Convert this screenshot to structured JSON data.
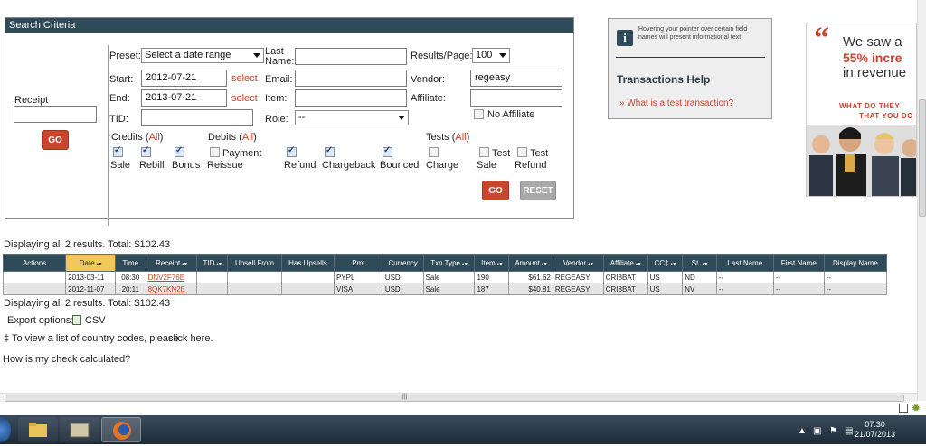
{
  "search": {
    "header": "Search Criteria",
    "receipt_label": "Receipt",
    "receipt_value": "",
    "go_left": "GO",
    "preset_label": "Preset:",
    "preset_value": "Select a date range",
    "start_label": "Start:",
    "start_value": "2012-07-21",
    "end_label": "End:",
    "end_value": "2013-07-21",
    "select_link": "select",
    "tid_label": "TID:",
    "tid_value": "",
    "lastname_label_1": "Last",
    "lastname_label_2": "Name:",
    "lastname_value": "",
    "email_label": "Email:",
    "email_value": "",
    "item_label": "Item:",
    "item_value": "",
    "role_label": "Role:",
    "role_value": "--",
    "results_label": "Results/Page:",
    "results_value": "100",
    "vendor_label": "Vendor:",
    "vendor_value": "regeasy",
    "affiliate_label": "Affiliate:",
    "affiliate_value": "",
    "no_affiliate_label": "No Affiliate",
    "credits_label": "Credits (",
    "debits_label": "Debits (",
    "tests_label": "Tests (",
    "all_link": "All",
    "close_paren": ")",
    "cb_sale": "Sale",
    "cb_rebill": "Rebill",
    "cb_bonus": "Bonus",
    "cb_payment": "Payment",
    "cb_reissue": "Reissue",
    "cb_refund": "Refund",
    "cb_chargeback": "Chargeback",
    "cb_bounced": "Bounced",
    "cb_charge": "Charge",
    "cb_test": "Test",
    "cb_test_sale": "Sale",
    "cb_test_refund": "Refund",
    "go_right": "GO",
    "reset": "RESET"
  },
  "help": {
    "hover_text": "Hovering your pointer over certain field names will present informational text.",
    "title": "Transactions Help",
    "link_bullet": "»",
    "link": "What is a test transaction?"
  },
  "ad": {
    "line1": "We saw a",
    "line2": "55% incre",
    "line3": "in revenue",
    "line4": "WHAT DO THEY",
    "line5": "THAT YOU DO"
  },
  "results": {
    "summary_top": "Displaying all 2 results.",
    "total_top": "Total: $102.43",
    "summary_bottom": "Displaying all 2 results.",
    "total_bottom": "Total: $102.43",
    "export_label": "Export options:",
    "csv": "CSV",
    "country_prefix": "‡ To view a list of country codes, please",
    "country_link": "click here.",
    "check_link": "How is my check calculated?",
    "columns": [
      "Actions",
      "Date",
      "Time",
      "Receipt",
      "TID",
      "Upsell From",
      "Has Upsells",
      "Pmt",
      "Currency",
      "Txn Type",
      "Item",
      "Amount",
      "Vendor",
      "Affiliate",
      "CC‡",
      "St.",
      "Last Name",
      "First Name",
      "Display Name"
    ],
    "rows": [
      [
        "",
        "2013-03-11",
        "08:30",
        "DNV2F76E",
        "",
        "",
        "",
        "PYPL",
        "USD",
        "Sale",
        "190",
        "$61.62",
        "REGEASY",
        "CRI8BAT",
        "US",
        "ND",
        "--",
        "--",
        "--"
      ],
      [
        "",
        "2012-11-07",
        "20:11",
        "8QK7KN2E",
        "",
        "",
        "",
        "VISA",
        "USD",
        "Sale",
        "187",
        "$40.81",
        "REGEASY",
        "CRI8BAT",
        "US",
        "NV",
        "--",
        "--",
        "--"
      ]
    ]
  },
  "taskbar": {
    "time": "07:30",
    "date": "21/07/2013"
  }
}
